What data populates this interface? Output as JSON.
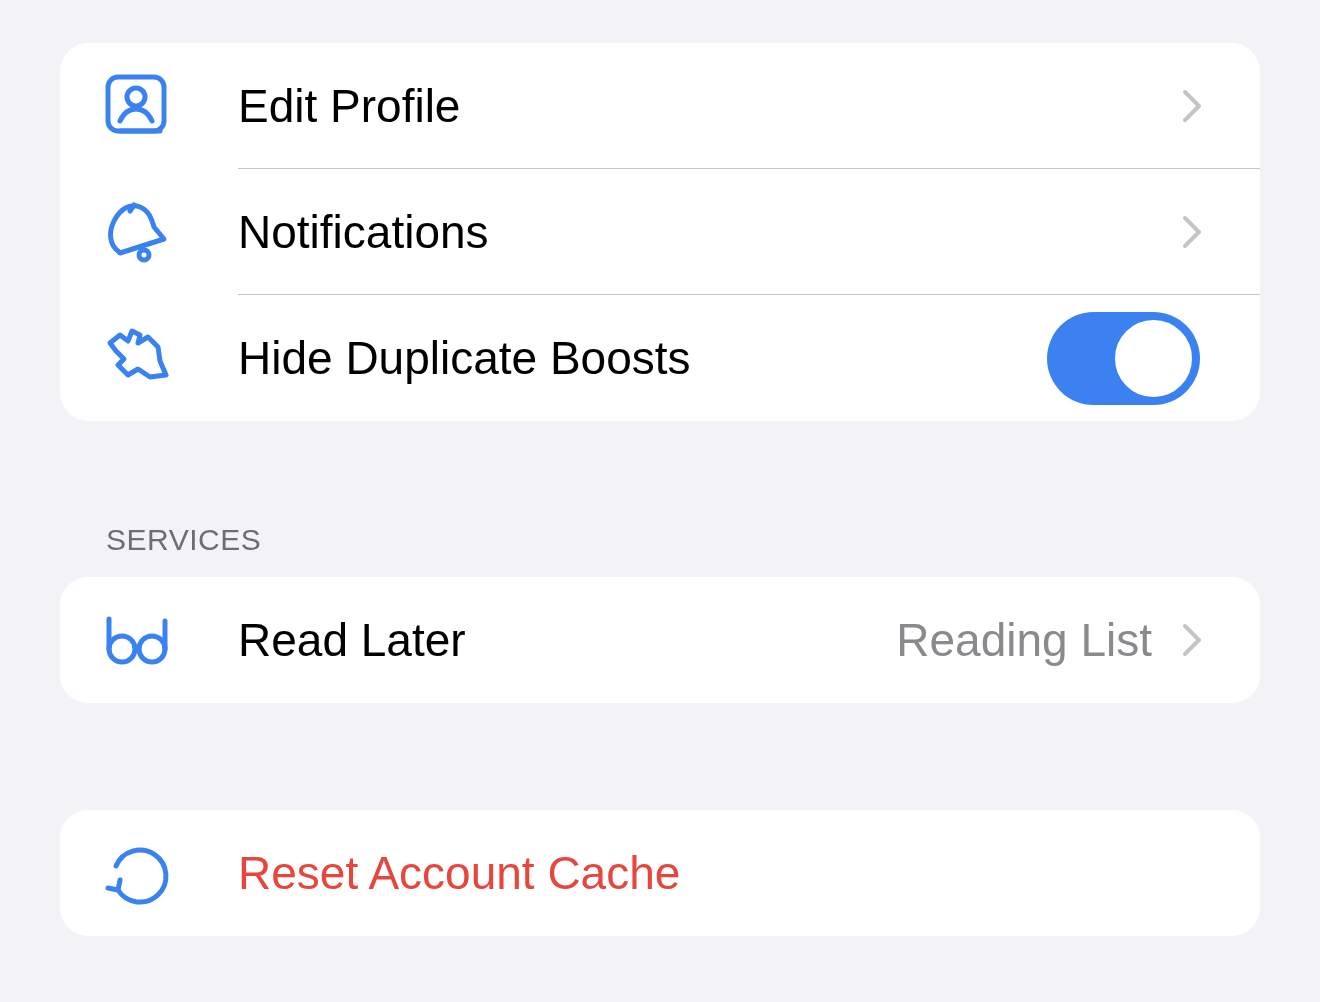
{
  "sections": [
    {
      "items": [
        {
          "kind": "link",
          "label": "Edit Profile"
        },
        {
          "kind": "link",
          "label": "Notifications"
        },
        {
          "kind": "toggle",
          "label": "Hide Duplicate Boosts",
          "on": true
        }
      ]
    },
    {
      "header": "SERVICES",
      "items": [
        {
          "kind": "link",
          "label": "Read Later",
          "value": "Reading List"
        }
      ]
    },
    {
      "items": [
        {
          "kind": "action",
          "label": "Reset Account Cache",
          "destructive": true
        }
      ]
    }
  ]
}
